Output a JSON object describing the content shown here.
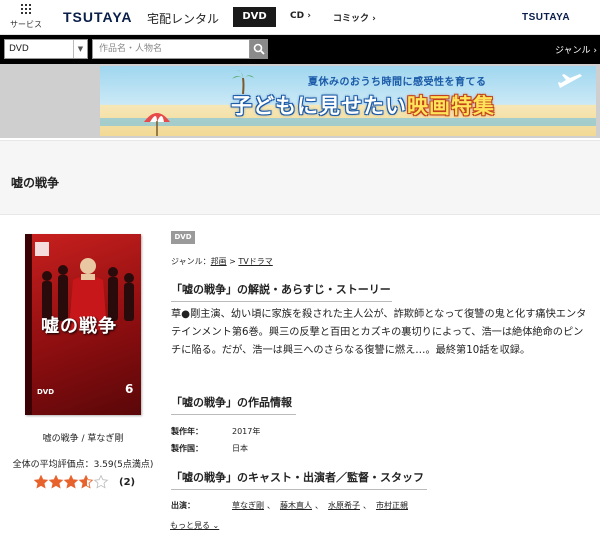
{
  "header": {
    "service_label": "サービス",
    "brand": "TSUTAYA",
    "rental_label": "宅配レンタル",
    "brand_right": "TSUTAYA",
    "nav": [
      {
        "label": "DVD",
        "active": true
      },
      {
        "label": "CD ›",
        "active": false
      },
      {
        "label": "コミック ›",
        "active": false
      }
    ]
  },
  "search": {
    "category_value": "DVD",
    "placeholder": "作品名・人物名",
    "genre_label": "ジャンル ›"
  },
  "banner": {
    "subtitle": "夏休みのおうち時間に感受性を育てる",
    "title_prefix": "子どもに見せたい",
    "title_highlight": "映画特集"
  },
  "page": {
    "title": "嘘の戦争"
  },
  "product": {
    "cover_title": "嘘の戦争",
    "cover_volume": "6",
    "cover_format": "DVD",
    "caption": "嘘の戦争 / 草なぎ剛",
    "average_text": "全体の平均評価点：3.59(5点満点)",
    "rating": 3.59,
    "rating_max": 5,
    "review_count": "(2)"
  },
  "detail": {
    "format_badge": "DVD",
    "genre_prefix": "ジャンル：",
    "genre_1": "邦画",
    "genre_sep": " > ",
    "genre_2": "TVドラマ",
    "synopsis_heading": "「嘘の戦争」の解説・あらすじ・ストーリー",
    "synopsis": "草●剛主演、幼い頃に家族を殺された主人公が、詐欺師となって復讐の鬼と化す痛快エンタテインメント第6巻。興三の反撃と百田とカズキの裏切りによって、浩一は絶体絶命のピンチに陥る。だが、浩一は興三へのさらなる復讐に燃え…。最終第10話を収録。",
    "info_heading": "「嘘の戦争」の作品情報",
    "info": [
      {
        "key": "製作年：",
        "value": "2017年"
      },
      {
        "key": "製作国：",
        "value": "日本"
      }
    ],
    "cast_heading": "「嘘の戦争」のキャスト・出演者／監督・スタッフ",
    "cast_key": "出演：",
    "cast": [
      "草なぎ剛",
      "藤木直人",
      "水原希子",
      "市村正親"
    ],
    "more_label": "もっと見る ⌄"
  },
  "colors": {
    "nav_active_bg": "#1a1a1a",
    "search_bar_bg": "#000000",
    "banner_title_highlight": "#ffe35a",
    "star_fill": "#e8622c",
    "cover_red": "#c8201e"
  }
}
